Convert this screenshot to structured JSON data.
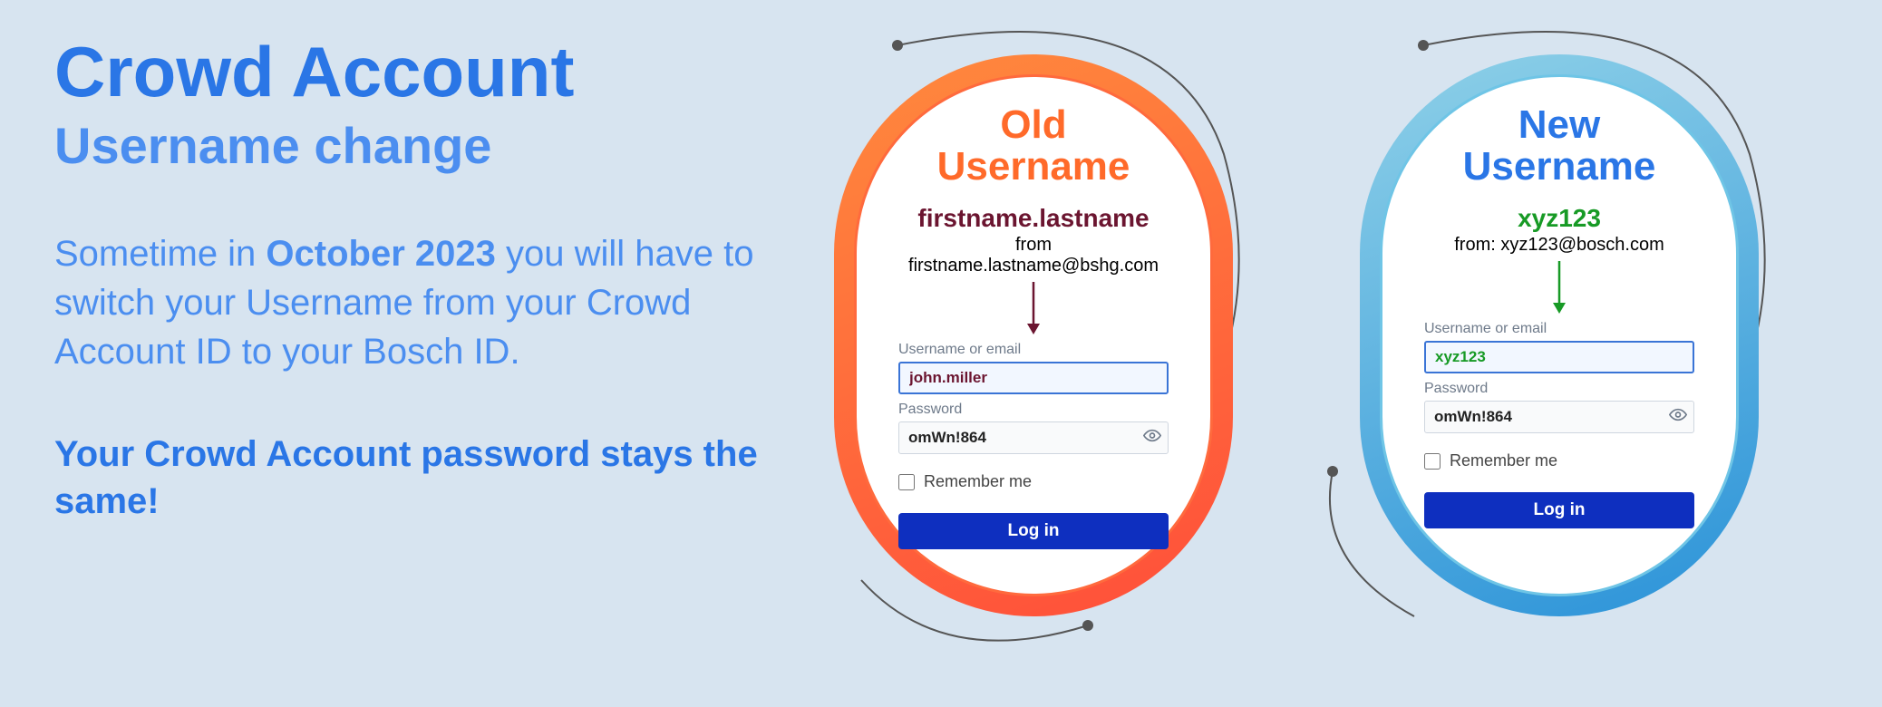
{
  "heading": {
    "line1": "Crowd Account",
    "line2": "Username change"
  },
  "body": {
    "pre": "Sometime in ",
    "bold": "October 2023",
    "post": " you will have to switch your Username from your Crowd Account ID to your Bosch ID."
  },
  "footer": "Your Crowd Account password stays the same!",
  "old": {
    "title_l1": "Old",
    "title_l2": "Username",
    "fmt": "firstname.lastname",
    "from": "from firstname.lastname@bshg.com",
    "user_label": "Username or email",
    "user_value": "john.miller",
    "pw_label": "Password",
    "pw_value": "omWn!864",
    "remember": "Remember me",
    "login": "Log in"
  },
  "new": {
    "title_l1": "New",
    "title_l2": "Username",
    "fmt": "xyz123",
    "from": "from: xyz123@bosch.com",
    "user_label": "Username or email",
    "user_value": "xyz123",
    "pw_label": "Password",
    "pw_value": "omWn!864",
    "remember": "Remember me",
    "login": "Log in"
  }
}
